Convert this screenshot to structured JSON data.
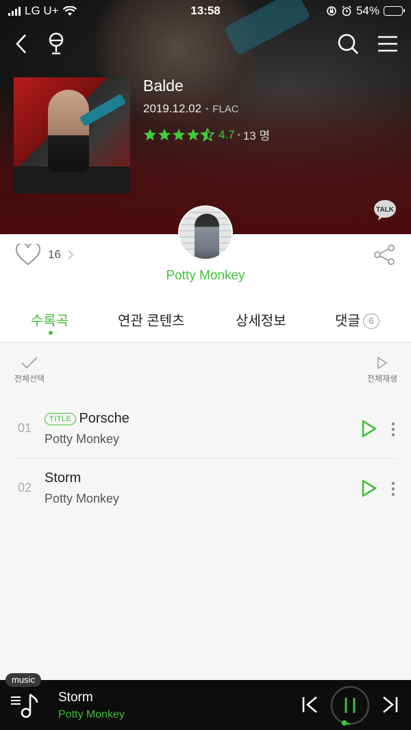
{
  "status_bar": {
    "carrier": "LG U+",
    "time": "13:58",
    "battery": "54%"
  },
  "album": {
    "title": "Balde",
    "date": "2019.12.02",
    "format": "FLAC",
    "rating": "4.7",
    "rating_count": "13 명"
  },
  "likes": {
    "count": "16"
  },
  "artist": {
    "name": "Potty Monkey"
  },
  "tabs": [
    {
      "label": "수록곡"
    },
    {
      "label": "연관 콘텐츠"
    },
    {
      "label": "상세정보"
    },
    {
      "label": "댓글",
      "badge": "6"
    }
  ],
  "list_actions": {
    "select_all": "전체선택",
    "play_all": "전체재생"
  },
  "tracks": [
    {
      "number": "01",
      "tag": "TITLE",
      "title": "Porsche",
      "artist": "Potty Monkey"
    },
    {
      "number": "02",
      "tag": "",
      "title": "Storm",
      "artist": "Potty Monkey"
    }
  ],
  "player": {
    "tag": "music",
    "title": "Storm",
    "artist": "Potty Monkey",
    "progress": 0.05
  },
  "colors": {
    "accent": "#3fbf3a",
    "player_bg": "#0d0d0d"
  }
}
